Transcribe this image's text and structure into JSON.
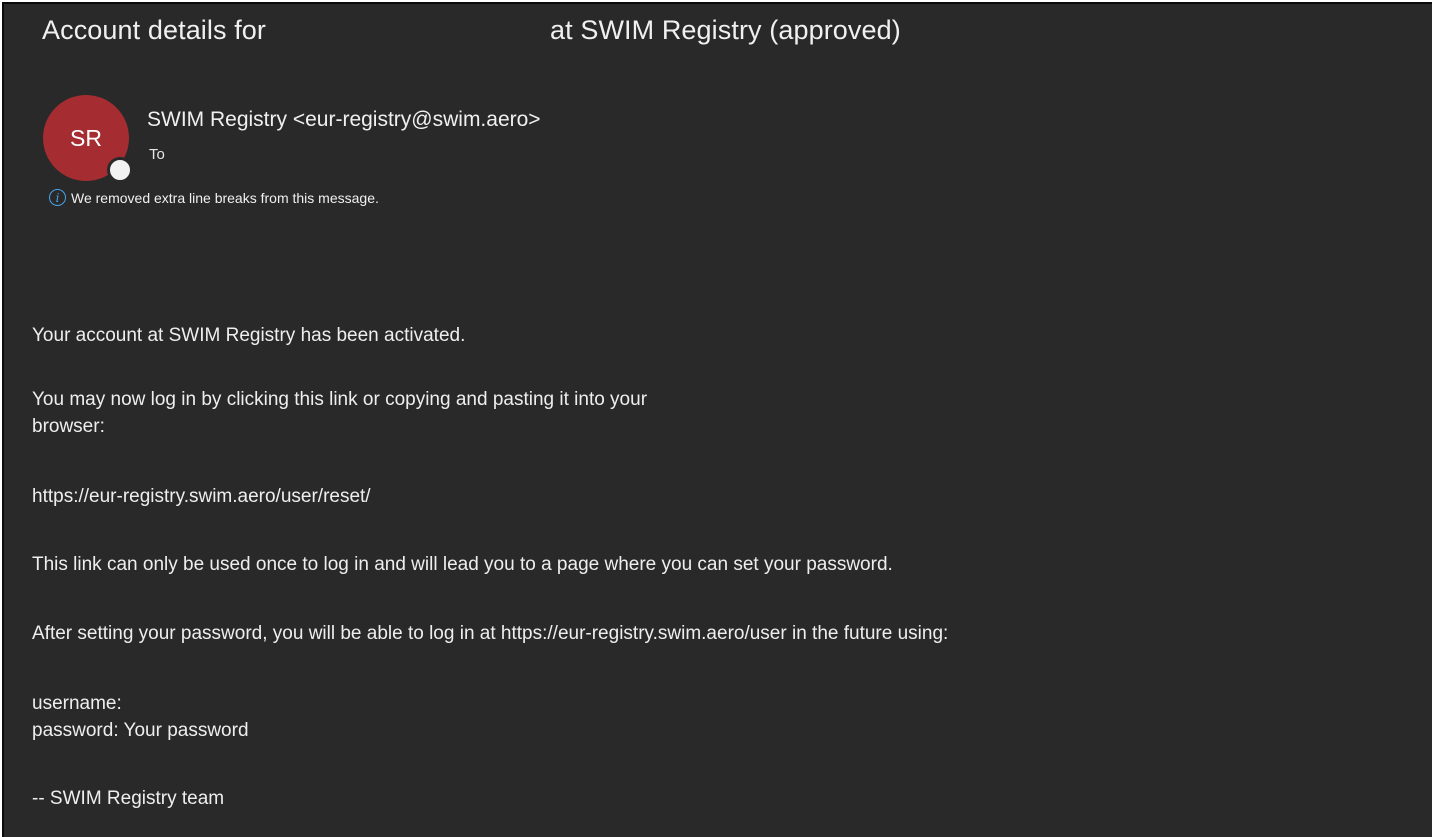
{
  "email": {
    "subject_prefix": "Account details for",
    "subject_suffix": "at SWIM Registry (approved)",
    "sender": {
      "initials": "SR",
      "avatar_color": "#a52d32",
      "display": "SWIM Registry <eur-registry@swim.aero>"
    },
    "to_label": "To",
    "notice": "We removed extra line breaks from this message.",
    "body": {
      "activated": "Your account at SWIM Registry has been activated.",
      "login_line1": "You may now log in by clicking this link or copying and pasting it into your",
      "login_line2": "browser:",
      "reset_link": "https://eur-registry.swim.aero/user/reset/",
      "link_once": "This link can only be used once to log in and will lead you to a page where you can set your password.",
      "after_setting": "After setting your password, you will be able to log in at https://eur-registry.swim.aero/user in the future using:",
      "username_label": "username:",
      "password_line": "password: Your password",
      "signature": "-- SWIM Registry team"
    }
  },
  "icons": {
    "notice_icon": "info-icon",
    "presence": "presence-status-icon"
  }
}
